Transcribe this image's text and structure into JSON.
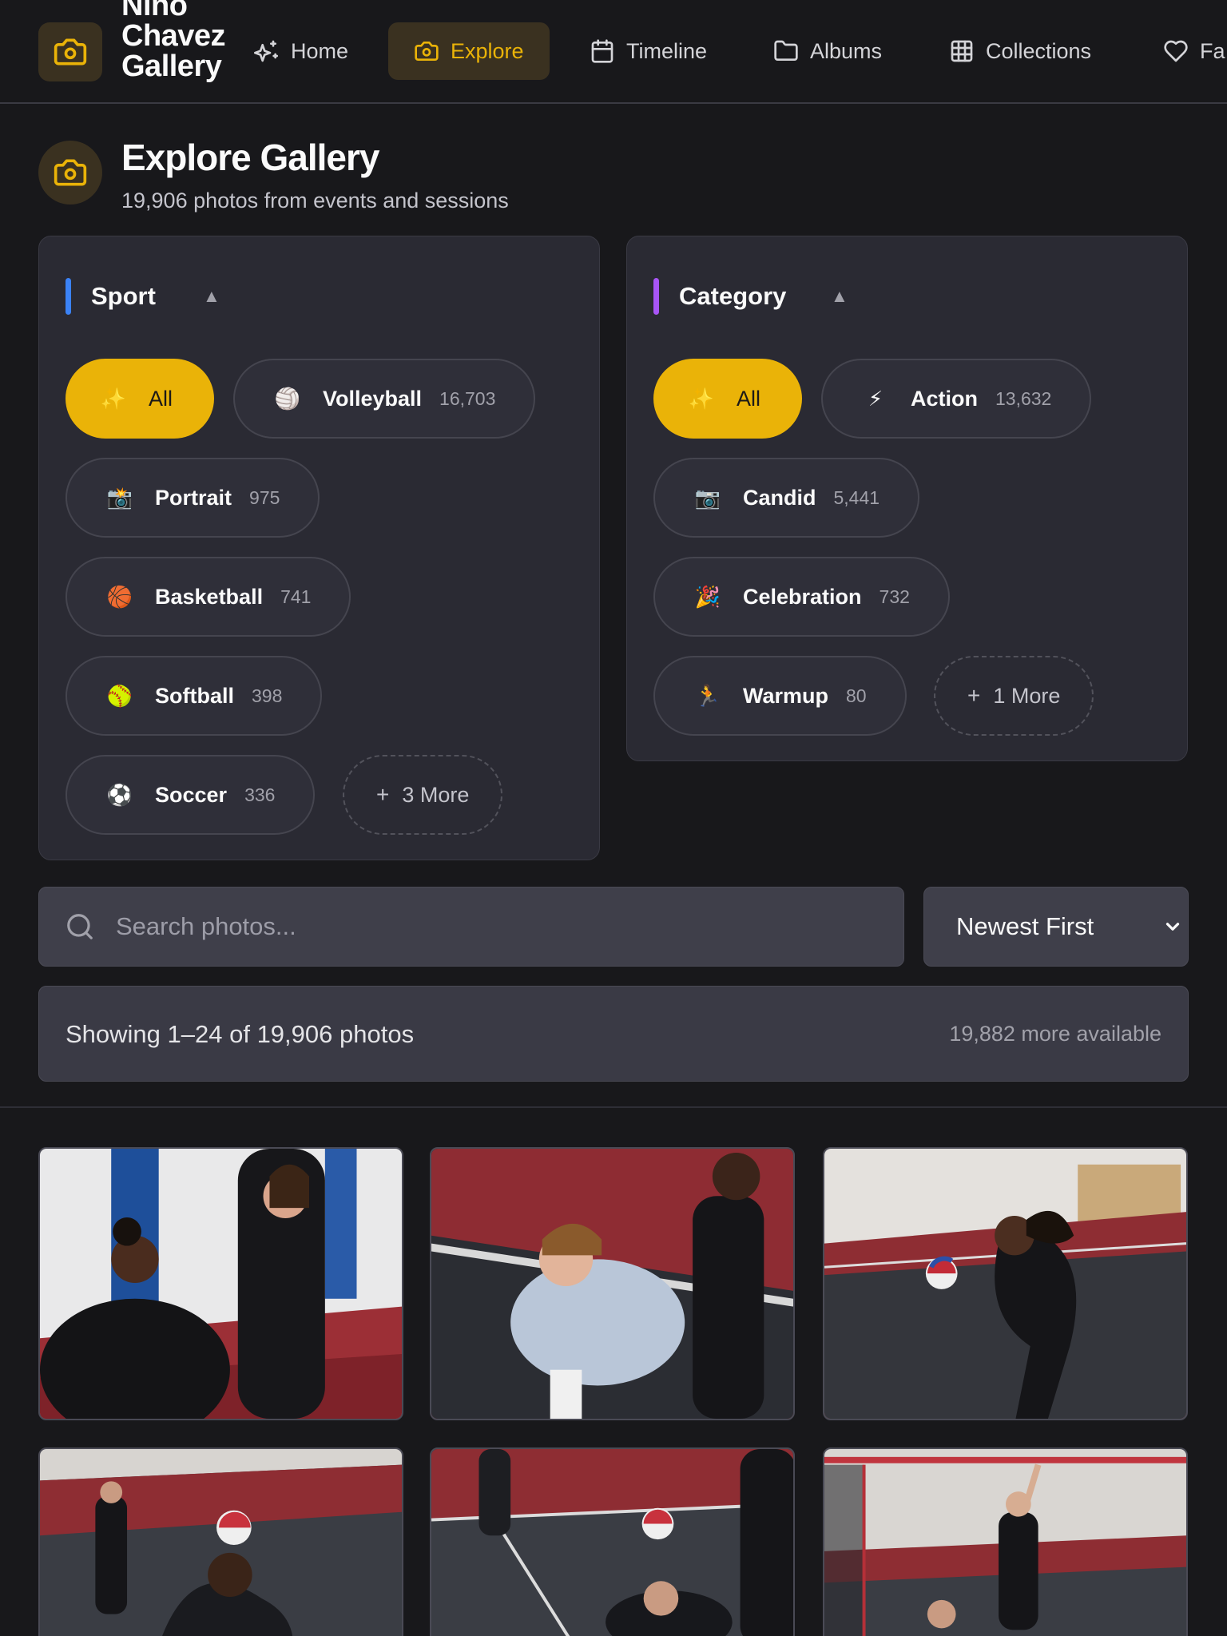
{
  "brand": {
    "title_lines": [
      "Nino",
      "Chavez",
      "Gallery"
    ],
    "logo_icon": "camera-icon"
  },
  "nav": {
    "items": [
      {
        "label": "Home",
        "icon": "sparkle-icon",
        "active": false
      },
      {
        "label": "Explore",
        "icon": "camera-icon",
        "active": true
      },
      {
        "label": "Timeline",
        "icon": "calendar-icon",
        "active": false
      },
      {
        "label": "Albums",
        "icon": "folder-icon",
        "active": false
      },
      {
        "label": "Collections",
        "icon": "grid-icon",
        "active": false
      },
      {
        "label": "Fa",
        "icon": "heart-icon",
        "active": false
      }
    ]
  },
  "header": {
    "title": "Explore Gallery",
    "subtitle": "19,906 photos from events and sessions"
  },
  "sport_filter": {
    "title": "Sport",
    "caret": "▲",
    "accent": "#3b82f6",
    "chips": [
      {
        "emoji": "✨",
        "label": "All",
        "count": "",
        "selected": true
      },
      {
        "emoji": "🏐",
        "label": "Volleyball",
        "count": "16,703",
        "selected": false
      },
      {
        "emoji": "📸",
        "label": "Portrait",
        "count": "975",
        "selected": false
      },
      {
        "emoji": "🏀",
        "label": "Basketball",
        "count": "741",
        "selected": false
      },
      {
        "emoji": "🥎",
        "label": "Softball",
        "count": "398",
        "selected": false
      },
      {
        "emoji": "⚽",
        "label": "Soccer",
        "count": "336",
        "selected": false
      }
    ],
    "more_label": "3 More"
  },
  "category_filter": {
    "title": "Category",
    "caret": "▲",
    "accent": "#a855f7",
    "chips": [
      {
        "emoji": "✨",
        "label": "All",
        "count": "",
        "selected": true
      },
      {
        "emoji": "⚡",
        "label": "Action",
        "count": "13,632",
        "selected": false
      },
      {
        "emoji": "📷",
        "label": "Candid",
        "count": "5,441",
        "selected": false
      },
      {
        "emoji": "🎉",
        "label": "Celebration",
        "count": "732",
        "selected": false
      },
      {
        "emoji": "🏃",
        "label": "Warmup",
        "count": "80",
        "selected": false
      }
    ],
    "more_label": "1 More"
  },
  "search": {
    "placeholder": "Search photos...",
    "value": ""
  },
  "sort": {
    "selected": "Newest First"
  },
  "status": {
    "showing": "Showing 1–24 of 19,906 photos",
    "more_available": "19,882 more available"
  },
  "photos": [
    {
      "alt": "volleyball-candid-1"
    },
    {
      "alt": "volleyball-candid-2"
    },
    {
      "alt": "volleyball-action-1"
    },
    {
      "alt": "volleyball-action-2"
    },
    {
      "alt": "volleyball-action-3"
    },
    {
      "alt": "volleyball-action-4"
    }
  ],
  "colors": {
    "accent": "#eab308",
    "background": "#18181b",
    "panel": "#2a2a33"
  }
}
